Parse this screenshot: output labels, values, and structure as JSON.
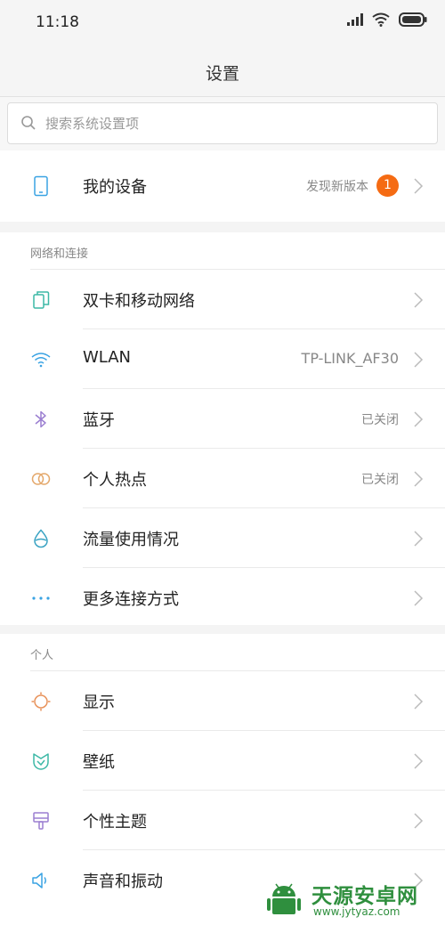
{
  "status_bar": {
    "time": "11:18"
  },
  "header": {
    "title": "设置"
  },
  "search": {
    "placeholder": "搜索系统设置项"
  },
  "my_device": {
    "label": "我的设备",
    "value": "发现新版本",
    "badge": "1"
  },
  "network": {
    "title": "网络和连接",
    "items": [
      {
        "label": "双卡和移动网络",
        "value": "",
        "icon": "dual-sim-icon"
      },
      {
        "label": "WLAN",
        "value": "TP-LINK_AF30",
        "icon": "wifi-icon"
      },
      {
        "label": "蓝牙",
        "value": "已关闭",
        "icon": "bluetooth-icon"
      },
      {
        "label": "个人热点",
        "value": "已关闭",
        "icon": "hotspot-icon"
      },
      {
        "label": "流量使用情况",
        "value": "",
        "icon": "data-usage-icon"
      },
      {
        "label": "更多连接方式",
        "value": "",
        "icon": "more-icon"
      }
    ]
  },
  "personal": {
    "title": "个人",
    "items": [
      {
        "label": "显示",
        "icon": "display-icon"
      },
      {
        "label": "壁纸",
        "icon": "wallpaper-icon"
      },
      {
        "label": "个性主题",
        "icon": "theme-icon"
      },
      {
        "label": "声音和振动",
        "icon": "sound-icon"
      }
    ]
  },
  "watermark": {
    "name": "天源安卓网",
    "url": "www.jytyaz.com"
  },
  "colors": {
    "badge": "#f56b13",
    "device_icon": "#3aa3e3",
    "sim_icon": "#3cb8a6",
    "wifi_icon": "#3aa3e3",
    "bluetooth_icon": "#9b7fd1",
    "hotspot_icon": "#e4a86b",
    "data_icon": "#3aa3c3",
    "more_icon": "#3aa3e3",
    "display_icon": "#e8925a",
    "wallpaper_icon": "#3cb8a6",
    "theme_icon": "#9b7fd1",
    "sound_icon": "#3aa3e3",
    "watermark": "#2f8f3e"
  }
}
